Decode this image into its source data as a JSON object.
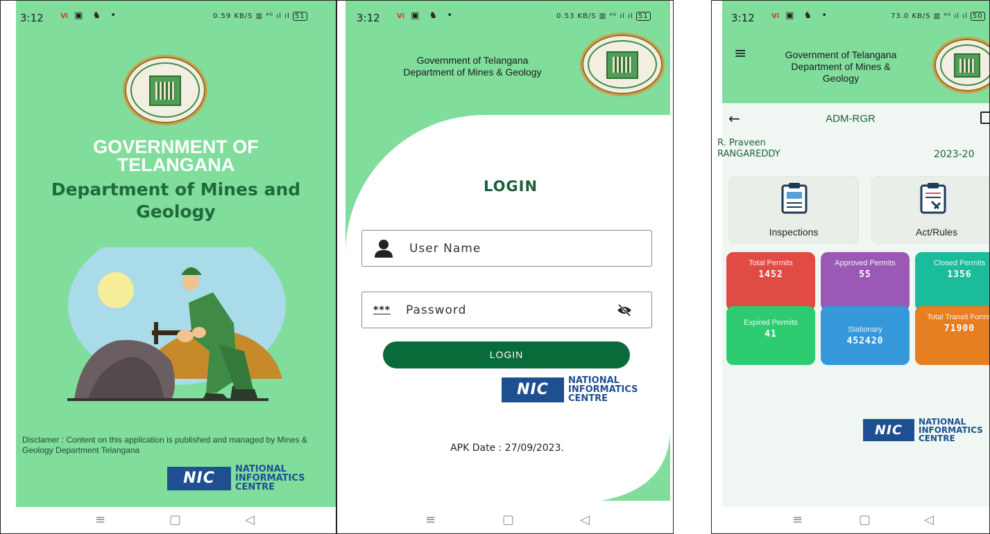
{
  "status_bar": {
    "time": "3:12",
    "panel1_speed": "0.59 KB/S",
    "panel2_speed": "0.53 KB/S",
    "panel3_speed": "73.0 KB/S",
    "panel1_battery": "51",
    "panel2_battery": "51",
    "panel3_battery": "50"
  },
  "splash": {
    "title_line1": "GOVERNMENT OF",
    "title_line2": "TELANGANA",
    "subtitle_line1": "Department of Mines and",
    "subtitle_line2": "Geology",
    "disclaimer": "Disclamer : Content on this application is published and managed by Mines & Geology Department Telangana"
  },
  "login": {
    "header_line1": "Government of Telangana",
    "header_line2": "Department of Mines & Geology",
    "title": "LOGIN",
    "username_placeholder": "User Name",
    "password_mask": "***",
    "password_placeholder": "Password",
    "button_label": "LOGIN",
    "apk_date": "APK Date : 27/09/2023."
  },
  "nic": {
    "logo_text": "NIC",
    "line1": "NATIONAL",
    "line2": "INFORMATICS",
    "line3": "CENTRE"
  },
  "dashboard": {
    "header_line1": "Government of Telangana",
    "header_line2": "Department of Mines &",
    "header_line3": "Geology",
    "toolbar_title": "ADM-RGR",
    "user_name": "R. Praveen",
    "district": "RANGAREDDY",
    "year": "2023-20",
    "cards": [
      {
        "label": "Inspections"
      },
      {
        "label": "Act/Rules"
      }
    ],
    "tiles": [
      {
        "title": "Total Permits",
        "value": "1452",
        "color": "#e04b44"
      },
      {
        "title": "Approved Permits",
        "value": "55",
        "color": "#9b59b6"
      },
      {
        "title": "Closed Permits",
        "value": "1356",
        "color": "#1abc9c"
      },
      {
        "title": "Expired Permits",
        "value": "41",
        "color": "#2ecc71"
      },
      {
        "title": "Stationary",
        "value": "452420",
        "color": "#3498db"
      },
      {
        "title": "Total Transit Forms",
        "value": "71900",
        "color": "#e67e22"
      }
    ]
  }
}
